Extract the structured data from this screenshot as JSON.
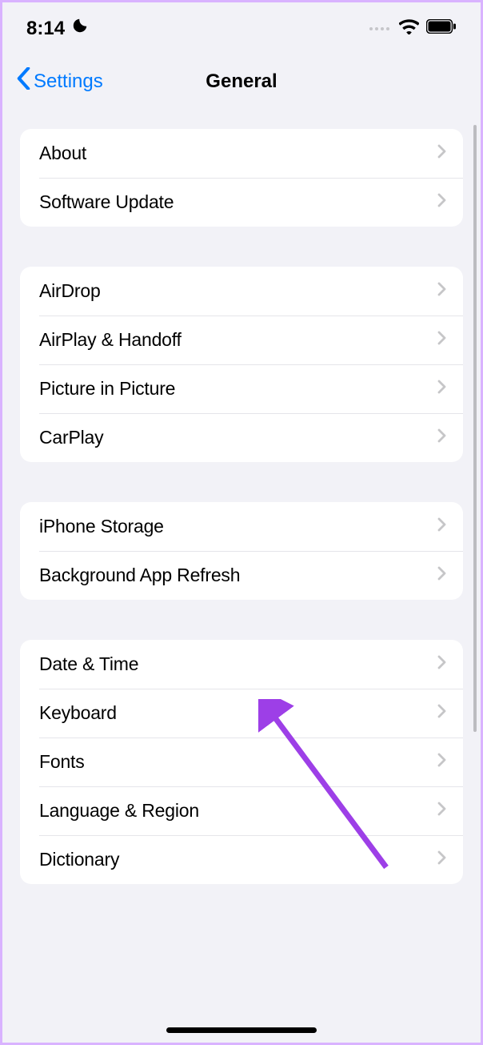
{
  "statusBar": {
    "time": "8:14"
  },
  "nav": {
    "back": "Settings",
    "title": "General"
  },
  "groups": [
    {
      "items": [
        {
          "label": "About"
        },
        {
          "label": "Software Update"
        }
      ]
    },
    {
      "items": [
        {
          "label": "AirDrop"
        },
        {
          "label": "AirPlay & Handoff"
        },
        {
          "label": "Picture in Picture"
        },
        {
          "label": "CarPlay"
        }
      ]
    },
    {
      "items": [
        {
          "label": "iPhone Storage"
        },
        {
          "label": "Background App Refresh"
        }
      ]
    },
    {
      "items": [
        {
          "label": "Date & Time"
        },
        {
          "label": "Keyboard"
        },
        {
          "label": "Fonts"
        },
        {
          "label": "Language & Region"
        },
        {
          "label": "Dictionary"
        }
      ]
    }
  ]
}
